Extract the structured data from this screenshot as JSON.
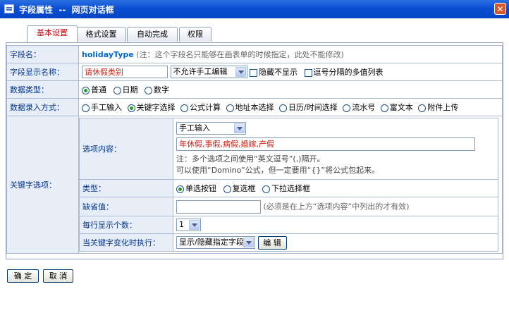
{
  "window": {
    "title": "字段属性  --  网页对话框",
    "close_label": "✕"
  },
  "tabs": [
    {
      "label": "基本设置",
      "active": true
    },
    {
      "label": "格式设置"
    },
    {
      "label": "自动完成"
    },
    {
      "label": "权限"
    }
  ],
  "rows": {
    "field_name": {
      "label": "字段名：",
      "value": "holidayType",
      "note": "(注：这个字段名只能够在画表单的时候指定，此处不能修改)"
    },
    "display_name": {
      "label": "字段显示名称：",
      "value": "请休假类别",
      "edit_select": "不允许手工编辑",
      "hide_label": "隐藏不显示",
      "multi_label": "逗号分隔的多值列表"
    },
    "data_type": {
      "label": "数据类型：",
      "options": [
        "普通",
        "日期",
        "数字"
      ],
      "selected": "普通"
    },
    "input_mode": {
      "label": "数据录入方式：",
      "options": [
        "手工输入",
        "关键字选择",
        "公式计算",
        "地址本选择",
        "日历/时间选择",
        "流水号",
        "富文本",
        "附件上传"
      ],
      "selected": "关键字选择"
    },
    "keyword": {
      "label": "关键字选项：",
      "choices": {
        "label": "选项内容：",
        "source_select": "手工输入",
        "value": "年休假,事假,病假,婚嫁,产假",
        "note1": "注：多个选项之间使用“英文逗号”(,)隔开。",
        "note2": "可以使用“Domino”公式，但一定要用“{}”将公式包起来。"
      },
      "type": {
        "label": "类型：",
        "options": [
          "单选按钮",
          "复选框",
          "下拉选择框"
        ],
        "selected": "单选按钮"
      },
      "default": {
        "label": "缺省值：",
        "value": "",
        "note": "(必须是在上方“选项内容”中列出的才有效)"
      },
      "per_row": {
        "label": "每行显示个数：",
        "value": "1"
      },
      "on_change": {
        "label": "当关键字变化时执行：",
        "value": "显示/隐藏指定字段",
        "edit_label": "编 辑"
      }
    }
  },
  "buttons": {
    "ok": "确 定",
    "cancel": "取 消"
  }
}
